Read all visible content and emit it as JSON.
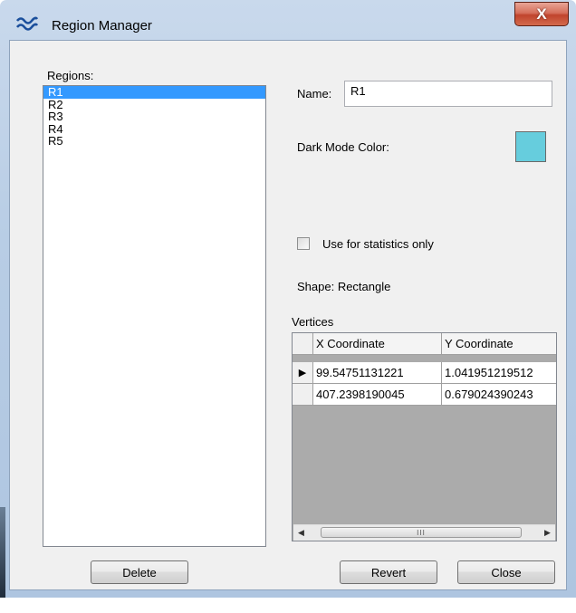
{
  "window": {
    "title": "Region Manager",
    "close_label": "X"
  },
  "regions": {
    "label": "Regions:",
    "items": [
      "R1",
      "R2",
      "R3",
      "R4",
      "R5"
    ],
    "selected": "R1"
  },
  "name": {
    "label": "Name:",
    "value": "R1"
  },
  "dark_mode": {
    "label": "Dark Mode Color:",
    "color": "#66cddd"
  },
  "stats_only": {
    "label": "Use for statistics only",
    "checked": false
  },
  "shape": {
    "text": "Shape: Rectangle"
  },
  "vertices": {
    "label": "Vertices",
    "columns": [
      "X Coordinate",
      "Y Coordinate"
    ],
    "rows": [
      [
        "99.54751131221",
        "1.041951219512"
      ],
      [
        "407.2398190045",
        "0.679024390243"
      ]
    ],
    "scroll_thumb": "III"
  },
  "buttons": {
    "delete": "Delete",
    "revert": "Revert",
    "close": "Close"
  }
}
